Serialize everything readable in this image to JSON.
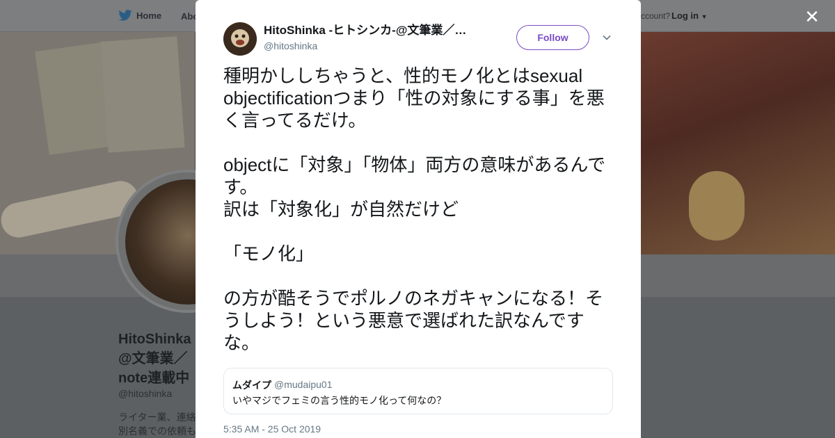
{
  "background": {
    "nav": {
      "home_label": "Home",
      "about_label": "Abo",
      "account_label": "ccount?",
      "login_label": "Log in"
    },
    "profile": {
      "name": "HitoShinka\n@文筆業／\nnote連載中",
      "handle": "@hitoshinka",
      "bio": "ライター業、連絡\n別名義での依頼も"
    }
  },
  "modal": {
    "author": {
      "name": "HitoShinka -ヒトシンカ-@文筆業／…",
      "handle": "@hitoshinka"
    },
    "follow_label": "Follow",
    "text": "種明かししちゃうと、性的モノ化とはsexual objectificationつまり「性の対象にする事」を悪く言ってるだけ。\n\nobjectに「対象」「物体」両方の意味があるんです。\n訳は「対象化」が自然だけど\n\n「モノ化」\n\nの方が酷そうでポルノのネガキャンになる！そうしよう！という悪意で選ばれた訳なんですな。",
    "quote": {
      "name": "ムダイプ",
      "handle": "@mudaipu01",
      "text": "いやマジでフェミの言う性的モノ化って何なの？"
    },
    "timestamp": "5:35 AM - 25 Oct 2019"
  },
  "colors": {
    "accent": "#794bc4",
    "text": "#14171a",
    "muted": "#657786",
    "overlay": "#5a5f63"
  },
  "icons": {
    "logo": "twitter-bird-icon",
    "close": "close-icon",
    "caret": "chevron-down-icon"
  }
}
